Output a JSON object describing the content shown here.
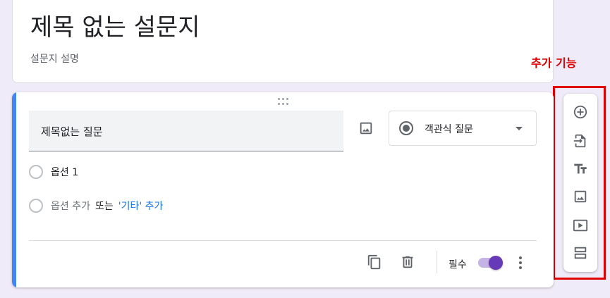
{
  "form": {
    "title": "제목 없는 설문지",
    "description": "설문지 설명"
  },
  "annotation": {
    "label": "추가 기능",
    "color": "#e00000"
  },
  "question": {
    "title": "제목없는 질문",
    "type_label": "객관식 질문",
    "options": [
      {
        "label": "옵션 1"
      }
    ],
    "add_option": {
      "add_label": "옵션 추가",
      "or_label": "또는",
      "other_label": "'기타' 추가"
    },
    "required_label": "필수",
    "required": true,
    "accent_color": "#4285f4"
  },
  "icons": {
    "image": "image-icon",
    "radio": "radio-button-icon",
    "dropdown": "chevron-down-icon",
    "copy": "copy-icon",
    "delete": "trash-icon",
    "more": "more-vert-icon",
    "drag": "drag-handle-icon"
  },
  "toolbar": {
    "items": [
      {
        "name": "add-question",
        "icon": "add-circle-icon"
      },
      {
        "name": "import-questions",
        "icon": "import-icon"
      },
      {
        "name": "add-title",
        "icon": "title-icon"
      },
      {
        "name": "add-image",
        "icon": "image-icon"
      },
      {
        "name": "add-video",
        "icon": "video-icon"
      },
      {
        "name": "add-section",
        "icon": "section-icon"
      }
    ]
  },
  "colors": {
    "background": "#f0ebf8",
    "primary": "#673ab7",
    "link": "#1a73e8"
  }
}
